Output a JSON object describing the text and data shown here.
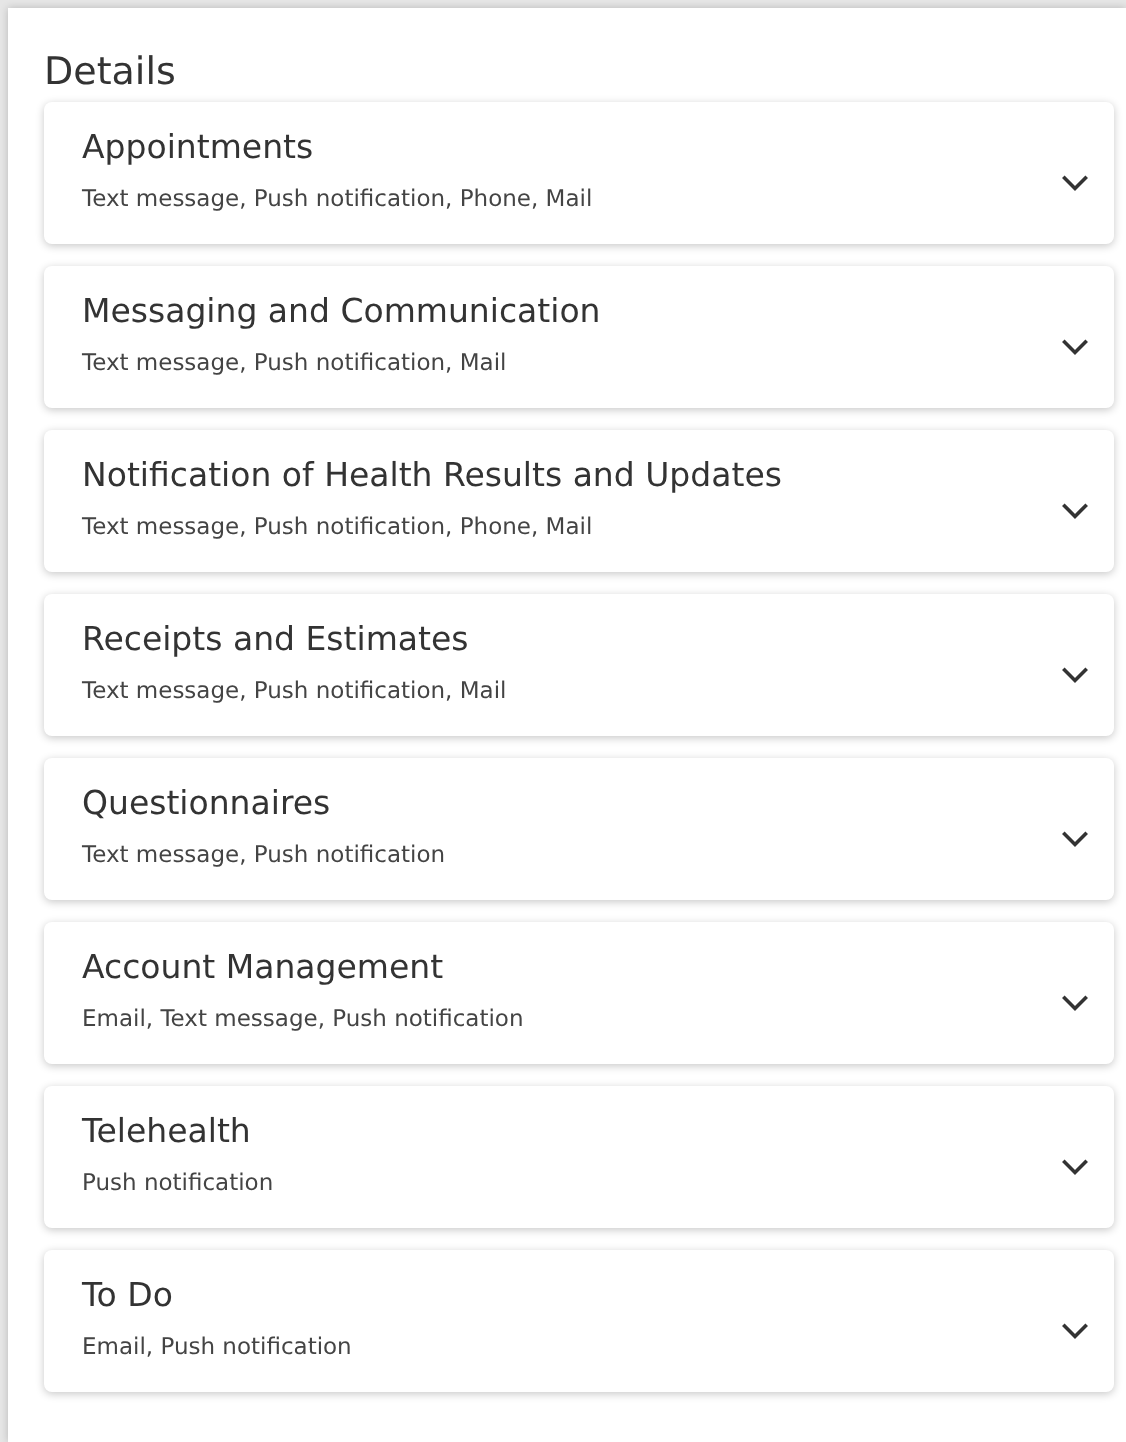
{
  "title": "Details",
  "sections": [
    {
      "title": "Appointments",
      "channels": "Text message, Push notification, Phone, Mail",
      "expanded": false
    },
    {
      "title": "Messaging and Communication",
      "channels": "Text message, Push notification, Mail",
      "expanded": false
    },
    {
      "title": "Notification of Health Results and Updates",
      "channels": "Text message, Push notification, Phone, Mail",
      "expanded": false
    },
    {
      "title": "Receipts and Estimates",
      "channels": "Text message, Push notification, Mail",
      "expanded": false
    },
    {
      "title": "Questionnaires",
      "channels": "Text message, Push notification",
      "expanded": false
    },
    {
      "title": "Account Management",
      "channels": "Email, Text message, Push notification",
      "expanded": false
    },
    {
      "title": "Telehealth",
      "channels": "Push notification",
      "expanded": false
    },
    {
      "title": "To Do",
      "channels": "Email, Push notification",
      "expanded": false
    }
  ]
}
